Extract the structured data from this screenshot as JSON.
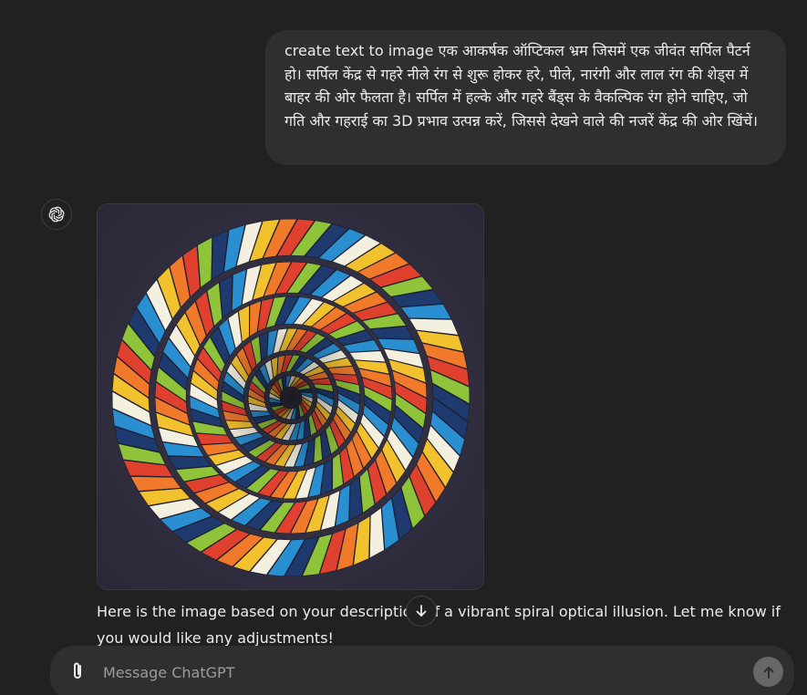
{
  "conversation": {
    "user_message": "create text to image एक आकर्षक ऑप्टिकल भ्रम जिसमें एक जीवंत सर्पिल पैटर्न हो। सर्पिल केंद्र से गहरे नीले रंग से शुरू होकर हरे, पीले, नारंगी और लाल रंग की शेड्स में बाहर की ओर फैलता है। सर्पिल में हल्के और गहरे बैंड्स के वैकल्पिक रंग होने चाहिए, जो गति और गहराई का 3D प्रभाव उत्पन्न करें, जिससे देखने वाले की नजरें केंद्र की ओर खिंचें।",
    "assistant_message": "Here is the image based on your description of a vibrant spiral optical illusion. Let me know if you would like any adjustments!"
  },
  "composer": {
    "placeholder": "Message ChatGPT"
  },
  "icons": {
    "avatar": "openai-logo-icon",
    "attach": "paperclip-icon",
    "send": "arrow-up-icon",
    "scroll": "arrow-down-icon"
  },
  "colors": {
    "background": "#212121",
    "bubble": "#2f2f2f",
    "spiral_bands": [
      "#1e3a6e",
      "#2a8fd0",
      "#f4f0e0",
      "#f2c12e",
      "#f07a2a",
      "#e0402e",
      "#8fc33a"
    ]
  }
}
